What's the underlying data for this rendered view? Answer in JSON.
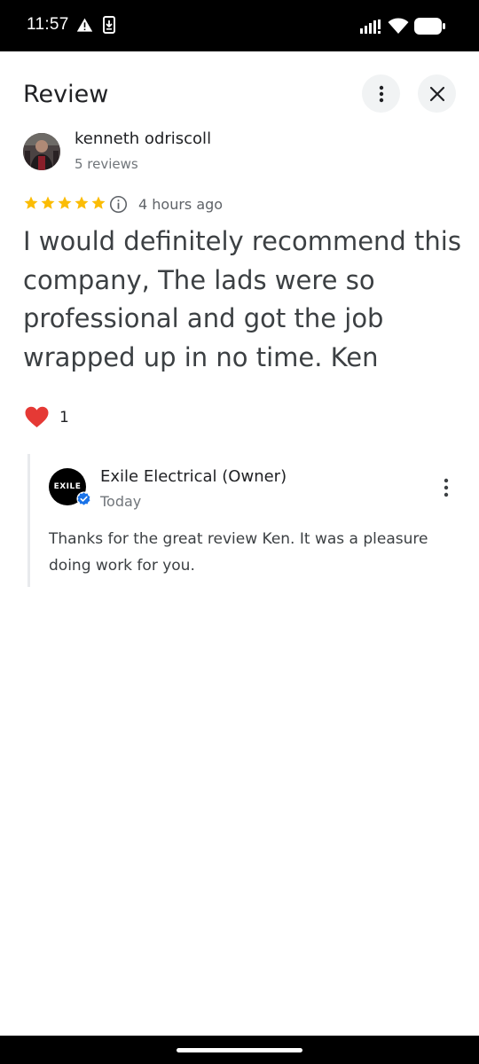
{
  "status_bar": {
    "time": "11:57",
    "icons": [
      "warning-icon",
      "download-icon",
      "signal-icon",
      "wifi-icon",
      "battery-icon"
    ]
  },
  "header": {
    "title": "Review",
    "more_icon": "more-vert-icon",
    "close_icon": "close-icon"
  },
  "review": {
    "reviewer_name": "kenneth odriscoll",
    "reviewer_count": "5 reviews",
    "rating": 5,
    "time_ago": "4 hours ago",
    "text": "I would definitely recommend this company, The lads were so professional and got the job wrapped up in no time. Ken",
    "reaction_count": "1"
  },
  "owner_reply": {
    "name": "Exile Electrical (Owner)",
    "date": "Today",
    "logo_text": "EXILE",
    "text": "Thanks for the great review Ken. It was a pleasure doing work for you."
  },
  "colors": {
    "star": "#fbbc04",
    "heart": "#e53935",
    "verified": "#1a73e8",
    "text_primary": "#202124",
    "text_secondary": "#70757a"
  }
}
